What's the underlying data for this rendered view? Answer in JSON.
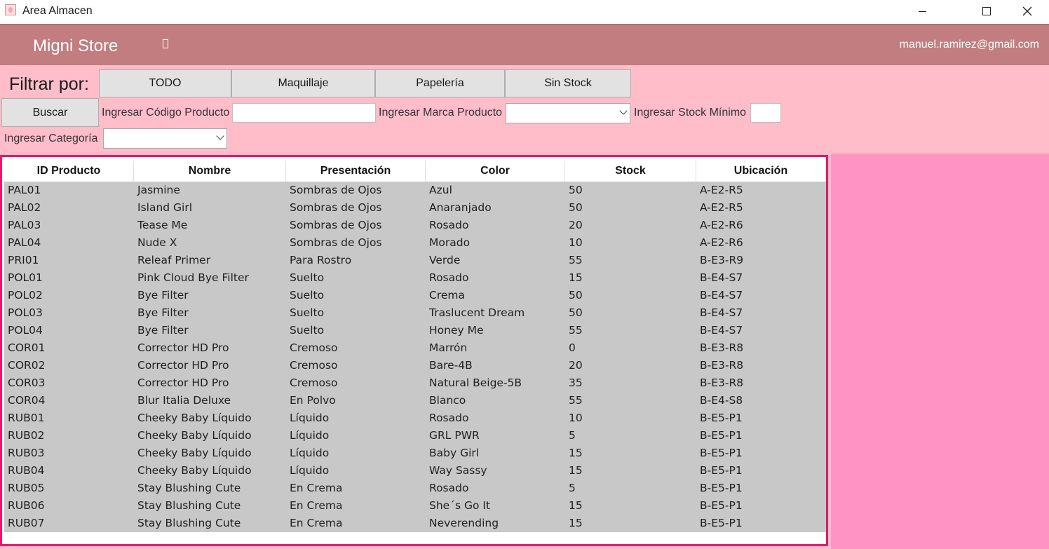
{
  "window": {
    "title": "Area Almacen"
  },
  "header": {
    "brand": "Migni Store",
    "user_email": "manuel.ramirez@gmail.com"
  },
  "filters": {
    "label": "Filtrar por:",
    "buttons": [
      "TODO",
      "Maquillaje",
      "Papelería",
      "Sin Stock"
    ],
    "search_button": "Buscar",
    "code_label": "Ingresar Código Producto",
    "code_value": "",
    "brand_label": "Ingresar Marca Producto",
    "brand_value": "",
    "stock_label": "Ingresar Stock Mínimo",
    "stock_value": "",
    "category_label": "Ingresar Categoría",
    "category_value": ""
  },
  "table": {
    "columns": [
      "ID Producto",
      "Nombre",
      "Presentación",
      "Color",
      "Stock",
      "Ubicación"
    ],
    "rows": [
      [
        "PAL01",
        "Jasmine",
        "Sombras de Ojos",
        "Azul",
        "50",
        "A-E2-R5"
      ],
      [
        "PAL02",
        "Island Girl",
        "Sombras de Ojos",
        "Anaranjado",
        "50",
        "A-E2-R5"
      ],
      [
        "PAL03",
        "Tease Me",
        "Sombras de Ojos",
        "Rosado",
        "20",
        "A-E2-R6"
      ],
      [
        "PAL04",
        "Nude X",
        "Sombras de Ojos",
        "Morado",
        "10",
        "A-E2-R6"
      ],
      [
        "PRI01",
        "Releaf Primer",
        "Para Rostro",
        "Verde",
        "55",
        "B-E3-R9"
      ],
      [
        "POL01",
        "Pink Cloud Bye Filter",
        "Suelto",
        "Rosado",
        "15",
        "B-E4-S7"
      ],
      [
        "POL02",
        "Bye Filter",
        "Suelto",
        "Crema",
        "50",
        "B-E4-S7"
      ],
      [
        "POL03",
        "Bye Filter",
        "Suelto",
        "Traslucent Dream",
        "50",
        "B-E4-S7"
      ],
      [
        "POL04",
        "Bye Filter",
        "Suelto",
        "Honey Me",
        "55",
        "B-E4-S7"
      ],
      [
        "COR01",
        "Corrector HD Pro",
        "Cremoso",
        "Marrón",
        "0",
        "B-E3-R8"
      ],
      [
        "COR02",
        "Corrector HD Pro",
        "Cremoso",
        "Bare-4B",
        "20",
        "B-E3-R8"
      ],
      [
        "COR03",
        "Corrector HD Pro",
        "Cremoso",
        "Natural Beige-5B",
        "35",
        "B-E3-R8"
      ],
      [
        "COR04",
        "Blur Italia Deluxe",
        "En Polvo",
        "Blanco",
        "55",
        "B-E4-S8"
      ],
      [
        "RUB01",
        "Cheeky Baby Líquido",
        "Líquido",
        "Rosado",
        "10",
        "B-E5-P1"
      ],
      [
        "RUB02",
        "Cheeky Baby Líquido",
        "Líquido",
        "GRL PWR",
        "5",
        "B-E5-P1"
      ],
      [
        "RUB03",
        "Cheeky Baby Líquido",
        "Líquido",
        "Baby Girl",
        "15",
        "B-E5-P1"
      ],
      [
        "RUB04",
        "Cheeky Baby Líquido",
        "Líquido",
        "Way Sassy",
        "15",
        "B-E5-P1"
      ],
      [
        "RUB05",
        "Stay Blushing Cute",
        "En Crema",
        "Rosado",
        "5",
        "B-E5-P1"
      ],
      [
        "RUB06",
        "Stay Blushing Cute",
        "En Crema",
        "She´s Go It",
        "15",
        "B-E5-P1"
      ],
      [
        "RUB07",
        "Stay Blushing Cute",
        "En Crema",
        "Neverending",
        "15",
        "B-E5-P1"
      ]
    ]
  }
}
